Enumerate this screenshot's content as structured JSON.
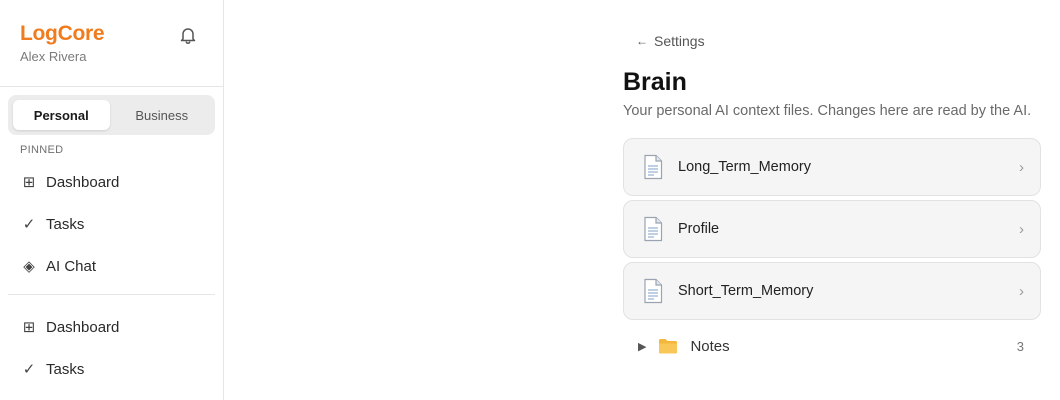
{
  "app": {
    "name": "LogCore",
    "user": "Alex Rivera"
  },
  "sidebar": {
    "tabs": [
      {
        "label": "Personal",
        "active": true
      },
      {
        "label": "Business",
        "active": false
      }
    ],
    "pinned_label": "PINNED",
    "pinned_items": [
      {
        "label": "Dashboard",
        "icon": "grid-icon"
      },
      {
        "label": "Tasks",
        "icon": "check-icon"
      },
      {
        "label": "AI Chat",
        "icon": "diamond-icon"
      }
    ],
    "items": [
      {
        "label": "Dashboard",
        "icon": "grid-icon"
      },
      {
        "label": "Tasks",
        "icon": "check-icon"
      }
    ]
  },
  "main": {
    "back_label": "Settings",
    "title": "Brain",
    "subtitle": "Your personal AI context files. Changes here are read by the AI.",
    "files": [
      {
        "name": "Long_Term_Memory",
        "icon": "document-icon"
      },
      {
        "name": "Profile",
        "icon": "document-icon"
      },
      {
        "name": "Short_Term_Memory",
        "icon": "document-icon"
      }
    ],
    "folder": {
      "name": "Notes",
      "count": "3",
      "icon": "folder-icon",
      "expanded": false
    }
  },
  "colors": {
    "brand": "#f07c1e",
    "card_bg": "#f5f5f5",
    "segment_bg": "#ececec"
  }
}
